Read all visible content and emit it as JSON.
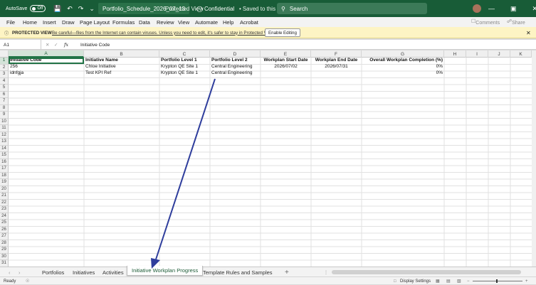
{
  "titlebar": {
    "autosave_label": "AutoSave",
    "autosave_state": "Off",
    "filename": "Portfolio_Schedule_2026_07_13",
    "protected": "Protected View",
    "sensitivity": "Confidential",
    "saved_state": "Saved to this PC",
    "search_placeholder": "Search"
  },
  "menu": [
    "File",
    "Home",
    "Insert",
    "Draw",
    "Page Layout",
    "Formulas",
    "Data",
    "Review",
    "View",
    "Automate",
    "Help",
    "Acrobat"
  ],
  "menu_right": {
    "comments": "Comments",
    "share": "Share"
  },
  "protected_bar": {
    "label": "PROTECTED VIEW",
    "message": "Be careful—files from the Internet can contain viruses. Unless you need to edit, it's safer to stay in Protected View.",
    "button": "Enable Editing"
  },
  "formula_bar": {
    "cell_ref": "A1",
    "fx": "fx",
    "value": "Initiative Code"
  },
  "columns": [
    "A",
    "B",
    "C",
    "D",
    "E",
    "F",
    "G",
    "H",
    "I",
    "J",
    "K"
  ],
  "row_count": 31,
  "sheet": {
    "headers": [
      "Initiative Code",
      "Initiative Name",
      "Portfolio Level 1",
      "Portfolio Level 2",
      "Workplan Start Date",
      "Workplan End Date",
      "Overall Workplan Completion (%)"
    ],
    "rows": [
      [
        "256",
        "Chloe Initiative",
        "Krypton QE Site 1",
        "Central Engineering",
        "2026/07/02",
        "2026/07/31",
        "0%"
      ],
      [
        "idnfgja",
        "Test KPI Ref",
        "Krypton QE Site 1",
        "Central Engineering",
        "",
        "",
        "0%"
      ]
    ]
  },
  "tabs": [
    "Portfolios",
    "Initiatives",
    "Activities",
    "Initiative Workplan Progress",
    "Template Rules and Samples"
  ],
  "active_tab": "Initiative Workplan Progress",
  "status": {
    "ready": "Ready",
    "display_settings": "Display Settings"
  },
  "colors": {
    "title_green": "#185c37",
    "accent": "#217346",
    "arrow": "#2e3d9c"
  }
}
